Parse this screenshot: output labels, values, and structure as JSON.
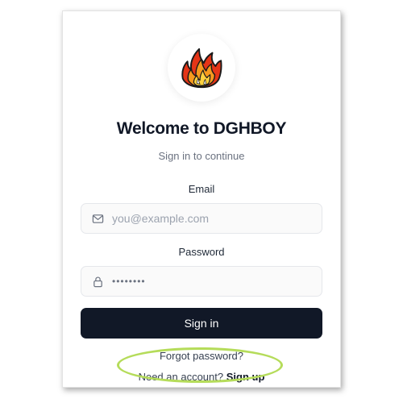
{
  "app": {
    "title": "Welcome to DGHBOY",
    "subtitle": "Sign in to continue"
  },
  "logo": {
    "icon": "fire-icon",
    "colors": {
      "outer": "#e53517",
      "mid": "#f79a1e",
      "inner": "#ffd23f",
      "outline": "#1a1a1a"
    }
  },
  "form": {
    "email_label": "Email",
    "email_placeholder": "you@example.com",
    "email_icon": "mail-icon",
    "password_label": "Password",
    "password_value": "••••••••",
    "password_icon": "lock-icon",
    "submit_label": "Sign in"
  },
  "links": {
    "forgot_password": "Forgot password?",
    "need_account": "Need an account?",
    "sign_up": "Sign up"
  },
  "theme": {
    "primary": "#111827",
    "muted": "#6b7280",
    "highlight": "#b5dc5a"
  }
}
